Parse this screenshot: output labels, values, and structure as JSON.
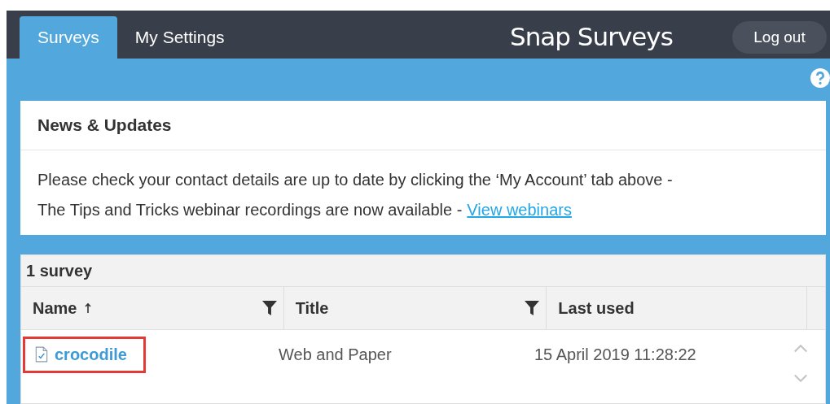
{
  "tabs": [
    {
      "label": "Surveys",
      "selected": true
    },
    {
      "label": "My Settings",
      "selected": false
    }
  ],
  "logo": "Snap Surveys",
  "logout_button": "Log out",
  "news": {
    "title": "News & Updates",
    "lines": [
      {
        "text": "Please check your contact details are up to date by clicking the ‘My Account’ tab above -"
      },
      {
        "text": "The Tips and Tricks webinar recordings are now available -",
        "link": "View webinars"
      }
    ]
  },
  "survey_list": {
    "count": "1 survey",
    "columns": [
      {
        "label": "Name",
        "sorted": true,
        "filter": true
      },
      {
        "label": "Title",
        "sorted": false,
        "filter": true
      },
      {
        "label": "Last used",
        "sorted": false,
        "filter": false
      }
    ],
    "rows": [
      {
        "name": "crocodile",
        "title": "Web and Paper",
        "last_used": "15 April 2019 11:28:22",
        "highlighted": true
      }
    ]
  }
}
